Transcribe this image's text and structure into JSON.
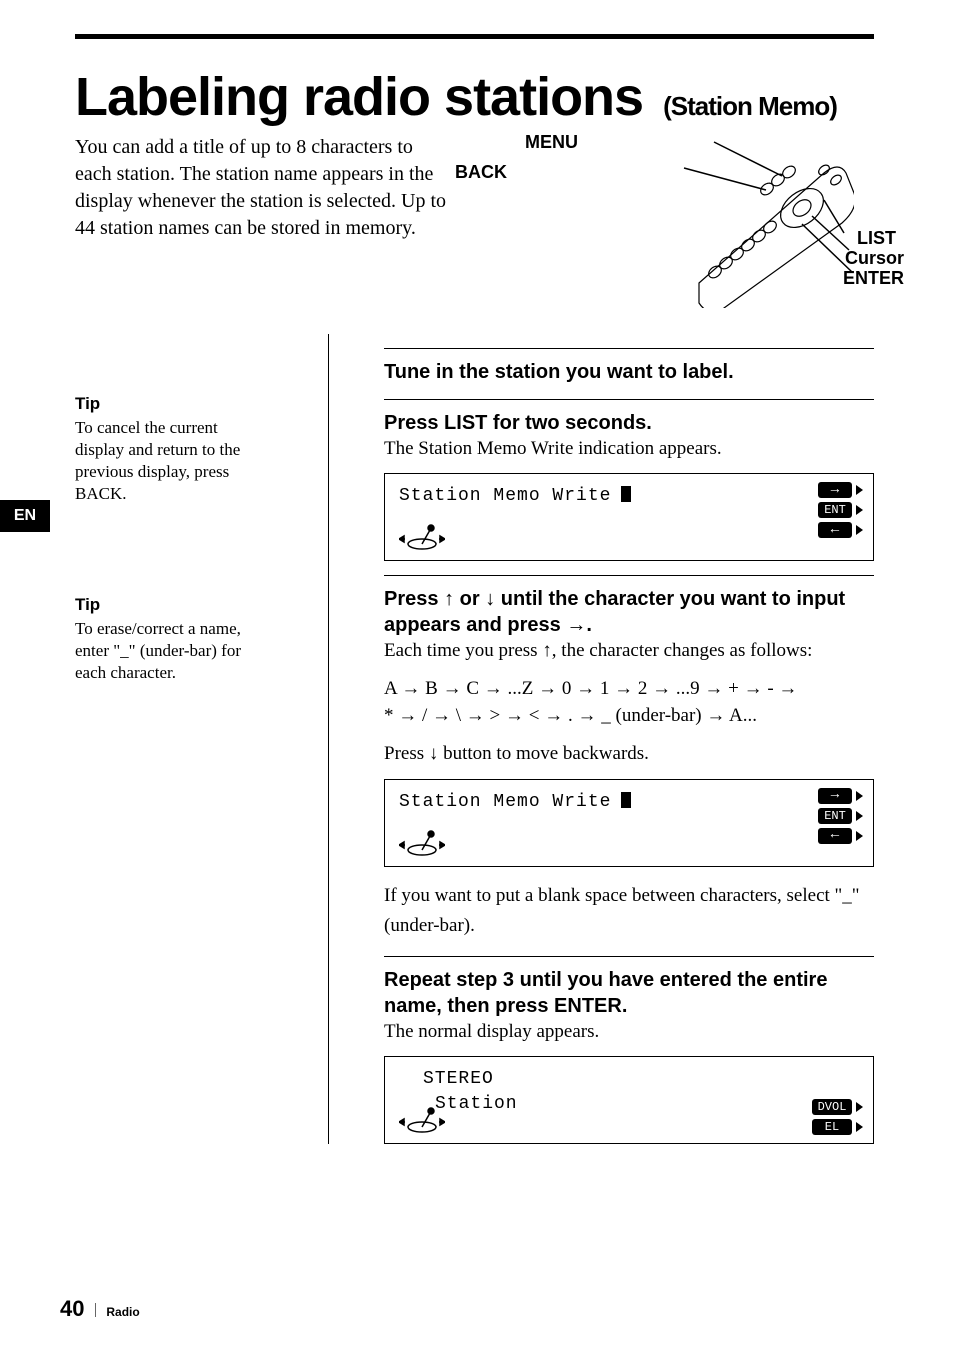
{
  "header": {
    "title": "Labeling radio stations",
    "subtitle": "(Station Memo)"
  },
  "intro": "You can add a title of up to 8 characters to each station.  The station name appears in the display whenever the station is selected.  Up to 44 station names can be stored in memory.",
  "remote_labels": {
    "menu": "MENU",
    "back": "BACK",
    "list": "LIST",
    "cursor": "Cursor",
    "enter": "ENTER"
  },
  "language_tab": "EN",
  "tips": [
    {
      "head": "Tip",
      "text": "To cancel the current display and return to the previous display, press BACK."
    },
    {
      "head": "Tip",
      "text": "To erase/correct a name, enter \"_\" (under-bar) for each character."
    }
  ],
  "steps": {
    "s1": {
      "head": "Tune in the station you want to label."
    },
    "s2": {
      "head": "Press LIST for two seconds.",
      "body": "The Station Memo Write indication appears.",
      "lcd_line": "Station Memo Write",
      "pills": [
        "→",
        "ENT",
        "←"
      ]
    },
    "s3": {
      "head_a": "Press ",
      "head_b": " or ",
      "head_c": " until the character you want to input appears and press ",
      "head_d": ".",
      "body1a": "Each time you press ",
      "body1b": ", the character changes as follows:",
      "seq1": "A → B → C → ...Z → 0 → 1 → 2 → ...9 → + → - →",
      "seq2": "* → / → \\ → > → < → . → _ (under-bar) → A...",
      "body2a": "Press ",
      "body2b": " button to move backwards.",
      "lcd_line": "Station Memo Write",
      "pills": [
        "→",
        "ENT",
        "←"
      ],
      "after": "If you want to put a blank space between characters, select \"_\"(under-bar)."
    },
    "s4": {
      "head": "Repeat step 3 until you have entered the entire name, then press ENTER.",
      "body": "The normal display appears.",
      "lcd_line1": "STEREO",
      "lcd_line2": "Station",
      "pills": [
        "DVOL",
        "EL"
      ]
    }
  },
  "footer": {
    "page": "40",
    "section": "Radio"
  }
}
